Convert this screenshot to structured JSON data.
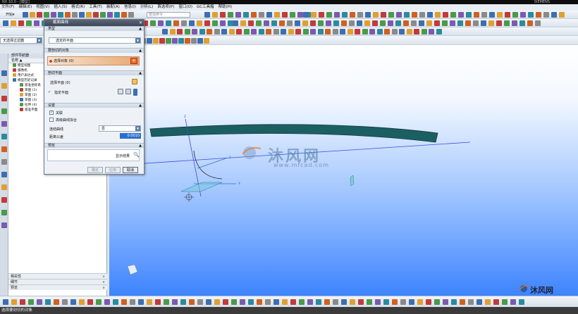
{
  "app": {
    "title": "NX 10.0 - [模型]",
    "title_right": "SIEMENS"
  },
  "menu": [
    "文件(F)",
    "编辑(E)",
    "视图(V)",
    "插入(S)",
    "格式(R)",
    "工具(T)",
    "装配(A)",
    "信息(I)",
    "分析(L)",
    "首选项(P)",
    "窗口(O)",
    "GC工具箱",
    "帮助(H)"
  ],
  "toolbar": {
    "start_label": "开始▾",
    "search_placeholder": "查找命令",
    "filter_select": "无选择过滤器"
  },
  "navigator": {
    "title": "部件导航器",
    "column_name": "名称",
    "items": [
      {
        "label": "模型视图",
        "indent": 0
      },
      {
        "label": "摄像机",
        "indent": 0
      },
      {
        "label": "用户表达式",
        "indent": 0
      },
      {
        "label": "模型历史记录",
        "indent": 0
      },
      {
        "label": "基准坐标系",
        "indent": 1
      },
      {
        "label": "草图 (1)",
        "indent": 1
      },
      {
        "label": "草图 (2)",
        "indent": 1
      },
      {
        "label": "草图 (3)",
        "indent": 1
      },
      {
        "label": "拉伸 (4)",
        "indent": 1
      },
      {
        "label": "基准平面",
        "indent": 1
      }
    ],
    "footer": [
      "相关性",
      "细节",
      "预览"
    ]
  },
  "dialog": {
    "title": "截面曲线",
    "type_section": "类型",
    "type_value": "选定的平面",
    "objects_section": "要剖切的对象",
    "objects_value": "选择对象 (0)",
    "plane_section": "剖切平面",
    "plane_select": "选择平面 (0)",
    "specify_plane": "指定平面",
    "settings_section": "设置",
    "associative": "关联",
    "join_curves": "高级曲线拟合",
    "join_label": "连结曲线",
    "join_value": "否",
    "tolerance_label": "距离公差",
    "tolerance_value": "0.0010",
    "preview_section": "预览",
    "show_result": "显示结果",
    "buttons": {
      "ok": "确定",
      "apply": "应用",
      "cancel": "取消"
    }
  },
  "watermark": {
    "cn": "沐风网",
    "url": "www.mfcad.com",
    "bottom": "沐风网"
  },
  "viewport": {
    "axis_x": "X",
    "axis_y": "Y",
    "axis_z": "Z"
  },
  "status": "选择要剖切的对象",
  "colors": {
    "accent_orange": "#f06a2a",
    "extrusion": "#1c5f62",
    "viewport_bottom": "#3d84ff"
  }
}
